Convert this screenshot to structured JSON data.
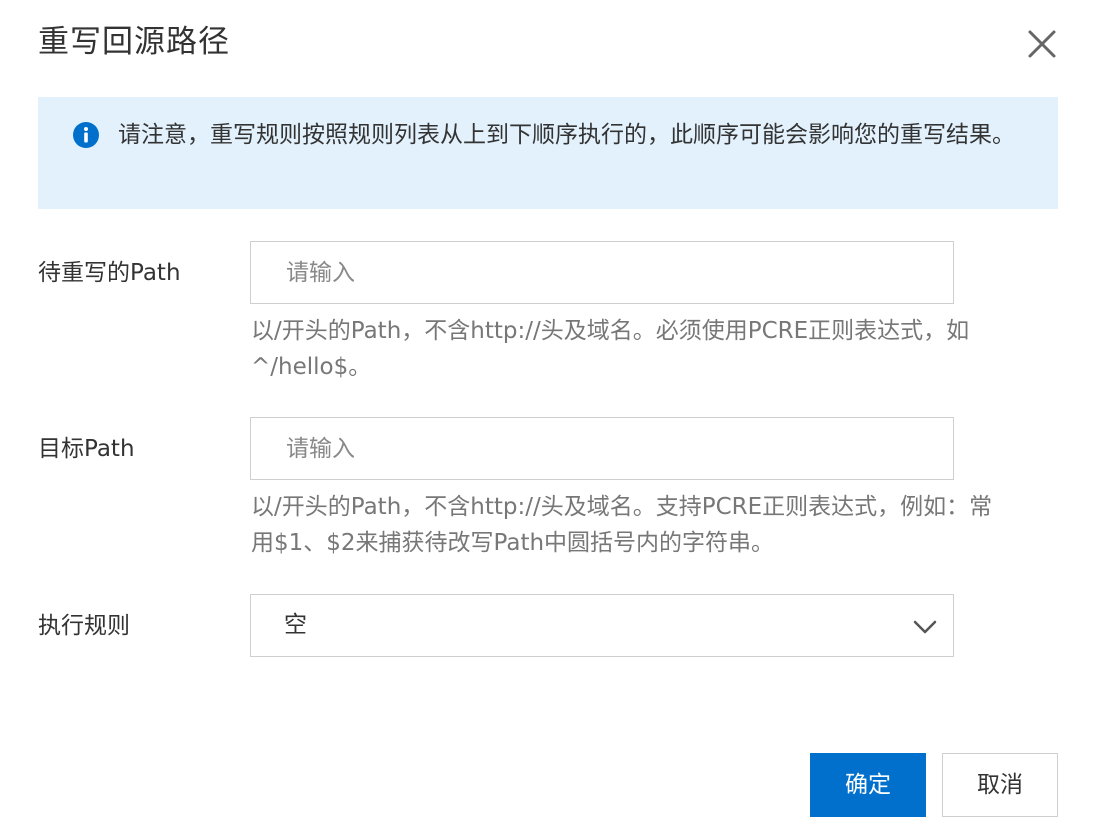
{
  "dialog": {
    "title": "重写回源路径",
    "close_icon": "close-icon"
  },
  "notice": {
    "icon": "info-icon",
    "text": "请注意，重写规则按照规则列表从上到下顺序执行的，此顺序可能会影响您的重写结果。",
    "background_color": "#e2f1fc",
    "icon_color": "#0070cc"
  },
  "form": {
    "source_path": {
      "label": "待重写的Path",
      "value": "",
      "placeholder": "请输入",
      "help": "以/开头的Path，不含http://头及域名。必须使用PCRE正则表达式，如^/hello$。"
    },
    "target_path": {
      "label": "目标Path",
      "value": "",
      "placeholder": "请输入",
      "help": "以/开头的Path，不含http://头及域名。支持PCRE正则表达式，例如：常用$1、$2来捕获待改写Path中圆括号内的字符串。"
    },
    "rule": {
      "label": "执行规则",
      "selected": "空",
      "icon": "chevron-down-icon"
    }
  },
  "footer": {
    "confirm_label": "确定",
    "cancel_label": "取消",
    "primary_color": "#0070cc"
  }
}
